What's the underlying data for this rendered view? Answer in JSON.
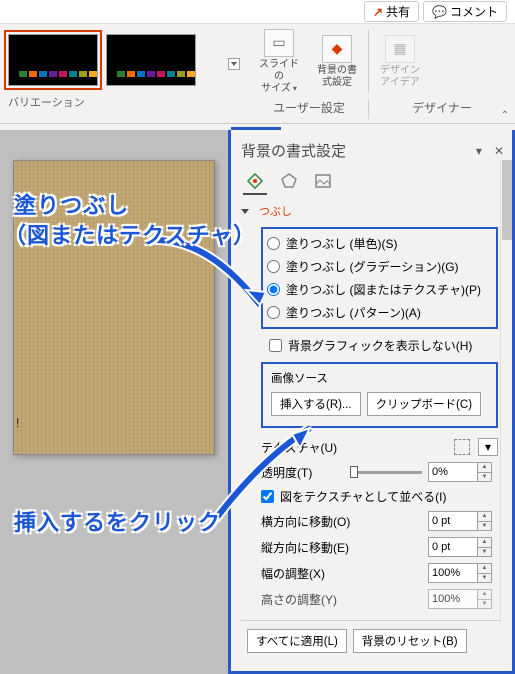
{
  "topbar": {
    "share": "共有",
    "comment": "コメント"
  },
  "ribbon": {
    "variation_label": "バリエーション",
    "slide_size": "スライドの\nサイズ",
    "bg_format": "背景の書\n式設定",
    "design_idea": "デザイン\nアイデア",
    "group_user": "ユーザー設定",
    "group_designer": "デザイナー"
  },
  "pane": {
    "title": "背景の書式設定",
    "section_trunc": "つぶし",
    "radios": {
      "solid": "塗りつぶし (単色)(S)",
      "gradient": "塗りつぶし (グラデーション)(G)",
      "picture": "塗りつぶし (図またはテクスチャ)(P)",
      "pattern": "塗りつぶし (パターン)(A)"
    },
    "hide_bg": "背景グラフィックを表示しない(H)",
    "img_src": "画像ソース",
    "insert_btn": "挿入する(R)...",
    "clipboard_btn": "クリップボード(C)",
    "texture": "テクスチャ(U)",
    "transparency": "透明度(T)",
    "transparency_val": "0%",
    "tile": "図をテクスチャとして並べる(I)",
    "offset_x": "横方向に移動(O)",
    "offset_x_val": "0 pt",
    "offset_y": "縦方向に移動(E)",
    "offset_y_val": "0 pt",
    "scale_x": "幅の調整(X)",
    "scale_x_val": "100%",
    "scale_y": "高さの調整(Y)",
    "scale_y_val": "100%",
    "apply_all": "すべてに適用(L)",
    "reset_bg": "背景のリセット(B)"
  },
  "annot": {
    "line1": "塗りつぶし",
    "line2": "（図またはテクスチャ）",
    "line3": "挿入するをクリック"
  },
  "thumb_colors": [
    "#2e7d32",
    "#ef6c00",
    "#0277bd",
    "#6a1b9a",
    "#c2185b",
    "#00838f",
    "#9e9d24",
    "#f9a825"
  ]
}
